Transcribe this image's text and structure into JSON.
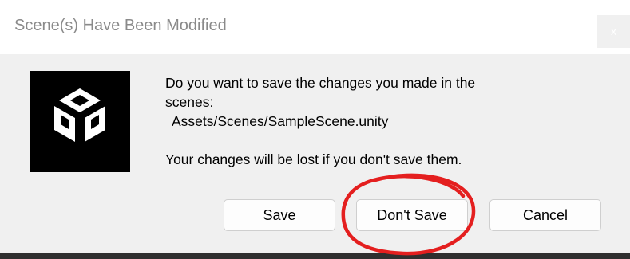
{
  "dialog": {
    "title": "Scene(s) Have Been Modified",
    "close_label": "x",
    "message_lines": [
      "Do you want to save the changes you made in the",
      "scenes:",
      "Assets/Scenes/SampleScene.unity"
    ],
    "warning": "Your changes will be lost if you don't save them.",
    "buttons": {
      "save": "Save",
      "dont_save": "Don't Save",
      "cancel": "Cancel"
    }
  },
  "icons": {
    "logo": "unity-logo-icon"
  },
  "annotation": {
    "color": "#e41f1f",
    "target": "Don't Save"
  }
}
